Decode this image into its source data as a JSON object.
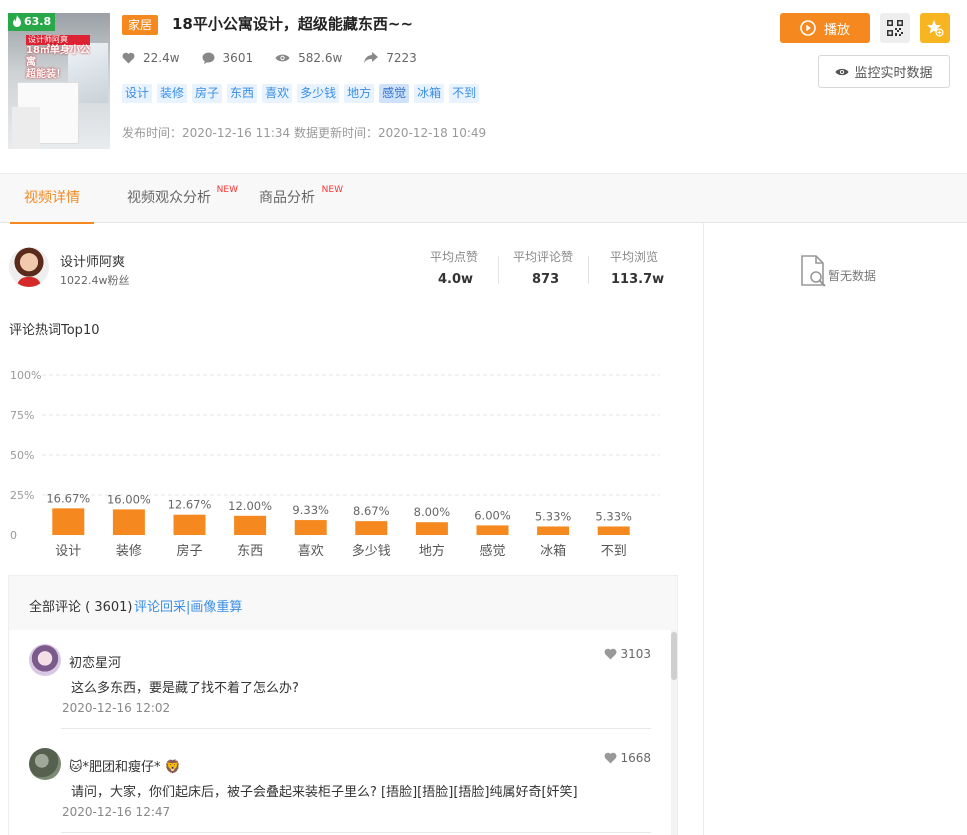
{
  "video": {
    "score": "63.8",
    "category": "家居",
    "title": "18平小公寓设计，超级能藏东西~~",
    "thumb_banner": [
      "设计师阿爽",
      "18㎡单身小公寓",
      "超能装！"
    ],
    "stats": {
      "likes": "22.4w",
      "comments": "3601",
      "views": "582.6w",
      "shares": "7223"
    },
    "tags": [
      {
        "label": "设计",
        "active": false
      },
      {
        "label": "装修",
        "active": false
      },
      {
        "label": "房子",
        "active": false
      },
      {
        "label": "东西",
        "active": false
      },
      {
        "label": "喜欢",
        "active": false
      },
      {
        "label": "多少钱",
        "active": false
      },
      {
        "label": "地方",
        "active": false
      },
      {
        "label": "感觉",
        "active": true
      },
      {
        "label": "冰箱",
        "active": false
      },
      {
        "label": "不到",
        "active": false
      }
    ],
    "publish_label": "发布时间：",
    "publish_time": "2020-12-16 11:34",
    "update_label": "数据更新时间：",
    "update_time": "2020-12-18 10:49"
  },
  "actions": {
    "play": "播放",
    "monitor": "监控实时数据"
  },
  "tabs": [
    {
      "label": "视频详情",
      "new": false,
      "active": true
    },
    {
      "label": "视频观众分析",
      "new": true,
      "active": false
    },
    {
      "label": "商品分析",
      "new": true,
      "active": false
    }
  ],
  "new_badge": "NEW",
  "author": {
    "name": "设计师阿爽",
    "fans": "1022.4w粉丝",
    "avg": [
      {
        "label": "平均点赞",
        "value": "4.0w"
      },
      {
        "label": "平均评论赞",
        "value": "873"
      },
      {
        "label": "平均浏览",
        "value": "113.7w"
      }
    ]
  },
  "side": {
    "no_data": "暂无数据"
  },
  "keywords_title": "评论热词Top10",
  "chart_data": {
    "type": "bar",
    "title": "",
    "categories": [
      "设计",
      "装修",
      "房子",
      "东西",
      "喜欢",
      "多少钱",
      "地方",
      "感觉",
      "冰箱",
      "不到"
    ],
    "values": [
      16.67,
      16.0,
      12.67,
      12.0,
      9.33,
      8.67,
      8.0,
      6.0,
      5.33,
      5.33
    ],
    "value_labels": [
      "16.67%",
      "16.00%",
      "12.67%",
      "12.00%",
      "9.33%",
      "8.67%",
      "8.00%",
      "6.00%",
      "5.33%",
      "5.33%"
    ],
    "yticks": [
      "0",
      "25%",
      "50%",
      "75%",
      "100%"
    ],
    "ylim": [
      0,
      100
    ],
    "grid": true,
    "color": "#f5891f"
  },
  "comments": {
    "label": "全部评论 ( 3601)",
    "link": "评论回采|画像重算",
    "items": [
      {
        "name": "初恋星河",
        "text": "这么多东西，要是藏了找不着了怎么办?",
        "date": "2020-12-16 12:02",
        "likes": "3103"
      },
      {
        "name": "🐱*肥团和瘦仔* 🦁",
        "text": "请问，大家，你们起床后，被子会叠起来装柜子里么? [捂脸][捂脸][捂脸]纯属好奇[奸笑]",
        "date": "2020-12-16 12:47",
        "likes": "1668"
      }
    ]
  }
}
